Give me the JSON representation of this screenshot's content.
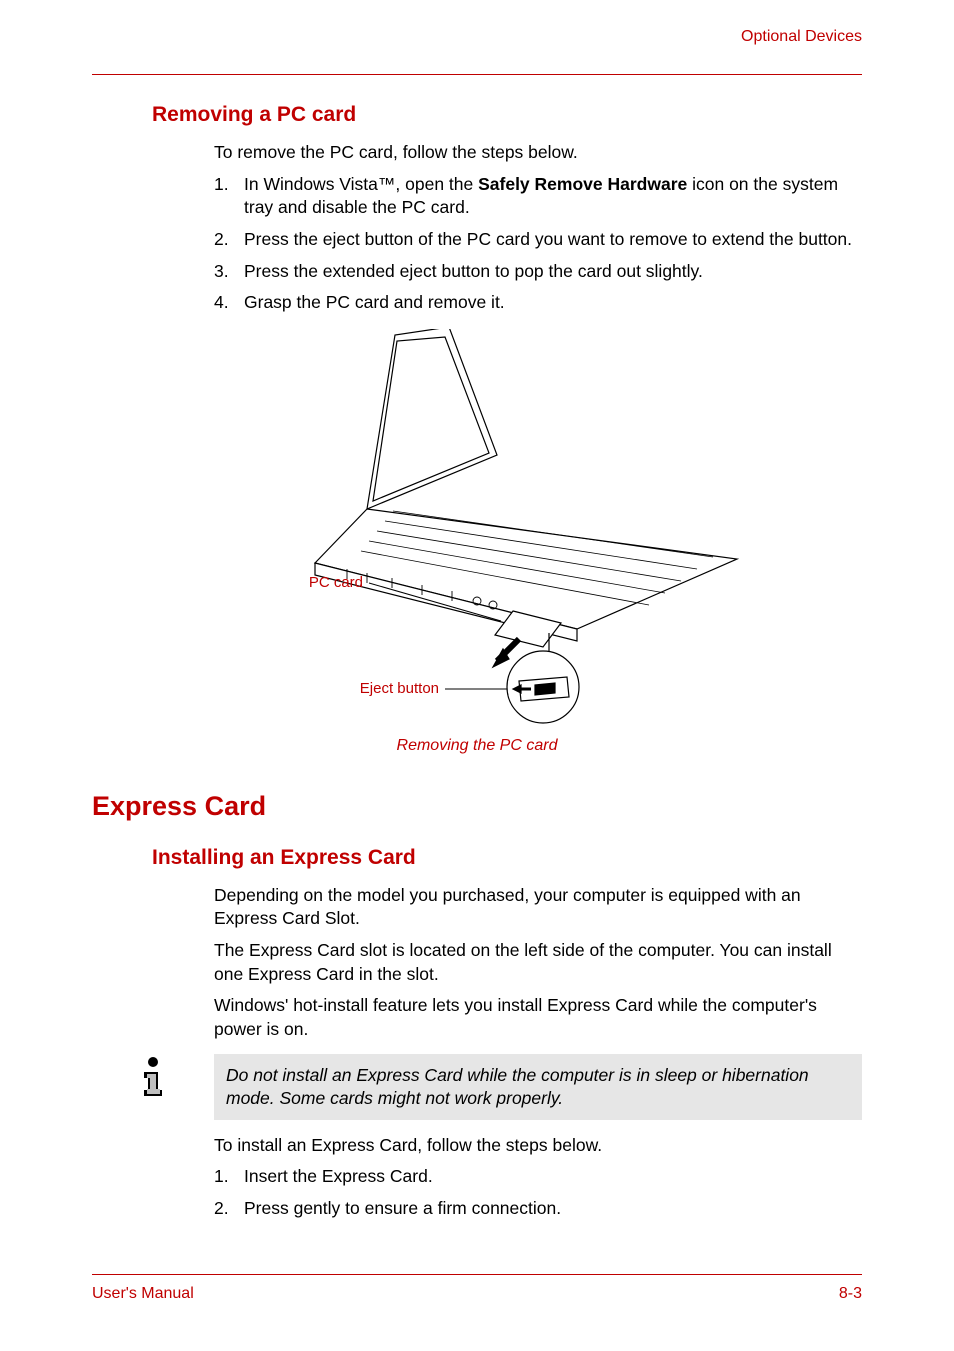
{
  "header": {
    "right": "Optional Devices"
  },
  "section1": {
    "title": "Removing a PC card",
    "intro": "To remove the PC card, follow the steps below.",
    "steps": [
      {
        "n": "1.",
        "pre": "In Windows Vista™, open the ",
        "bold": "Safely Remove Hardware",
        "post": " icon on the system tray and disable the PC card."
      },
      {
        "n": "2.",
        "pre": "Press the eject button of the PC card you want to remove to extend the button.",
        "bold": "",
        "post": ""
      },
      {
        "n": "3.",
        "pre": "Press the extended eject button to pop the card out slightly.",
        "bold": "",
        "post": ""
      },
      {
        "n": "4.",
        "pre": "Grasp the PC card and remove it.",
        "bold": "",
        "post": ""
      }
    ],
    "figure": {
      "label_pc_card": "PC card",
      "label_eject": "Eject button",
      "caption": "Removing the PC card"
    }
  },
  "section2": {
    "title": "Express Card",
    "sub_title": "Installing an Express Card",
    "paragraphs": [
      "Depending on the model you purchased, your computer is equipped with an Express Card Slot.",
      "The Express Card slot is located on the left side of the computer. You can install one Express Card in the slot.",
      "Windows' hot-install feature lets you install Express Card while the computer's power is on."
    ],
    "note": "Do not install an Express Card while the computer is in sleep or hibernation mode. Some cards might not work properly.",
    "after_note": "To install an Express Card, follow the steps below.",
    "steps2": [
      {
        "n": "1.",
        "t": "Insert the Express Card."
      },
      {
        "n": "2.",
        "t": "Press gently to ensure a firm connection."
      }
    ]
  },
  "footer": {
    "left": "User's Manual",
    "right": "8-3"
  }
}
